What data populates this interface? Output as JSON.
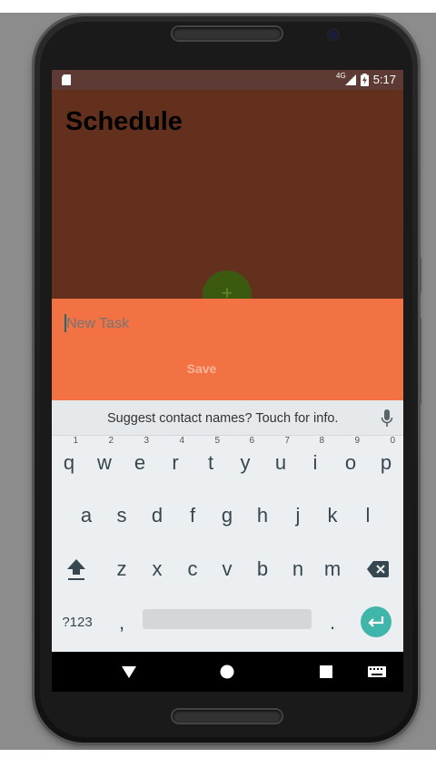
{
  "status_bar": {
    "network": "4G",
    "time": "5:17"
  },
  "app": {
    "title": "Schedule",
    "fab_label": "+"
  },
  "task_sheet": {
    "input_placeholder": "New Task",
    "input_value": "",
    "save_label": "Save"
  },
  "keyboard": {
    "suggestion": "Suggest contact names? Touch for info.",
    "row1": [
      {
        "key": "q",
        "hint": "1"
      },
      {
        "key": "w",
        "hint": "2"
      },
      {
        "key": "e",
        "hint": "3"
      },
      {
        "key": "r",
        "hint": "4"
      },
      {
        "key": "t",
        "hint": "5"
      },
      {
        "key": "y",
        "hint": "6"
      },
      {
        "key": "u",
        "hint": "7"
      },
      {
        "key": "i",
        "hint": "8"
      },
      {
        "key": "o",
        "hint": "9"
      },
      {
        "key": "p",
        "hint": "0"
      }
    ],
    "row2": [
      "a",
      "s",
      "d",
      "f",
      "g",
      "h",
      "j",
      "k",
      "l"
    ],
    "row3": [
      "z",
      "x",
      "c",
      "v",
      "b",
      "n",
      "m"
    ],
    "symbols_label": "?123",
    "comma_label": ",",
    "period_label": "."
  },
  "colors": {
    "status_bar": "#5d3a34",
    "app_bar": "#63301d",
    "fab": "#3b5a10",
    "sheet": "#f37244",
    "keyboard": "#eceff1",
    "enter_key": "#40b5a9"
  },
  "icons": {
    "status_left": "sd-card-icon",
    "status_right": [
      "signal-icon",
      "battery-charging-icon"
    ],
    "keyboard": [
      "mic-icon",
      "shift-icon",
      "backspace-icon",
      "enter-icon"
    ],
    "navigation": [
      "back-icon",
      "home-icon",
      "recents-icon",
      "keyboard-switch-icon"
    ]
  }
}
